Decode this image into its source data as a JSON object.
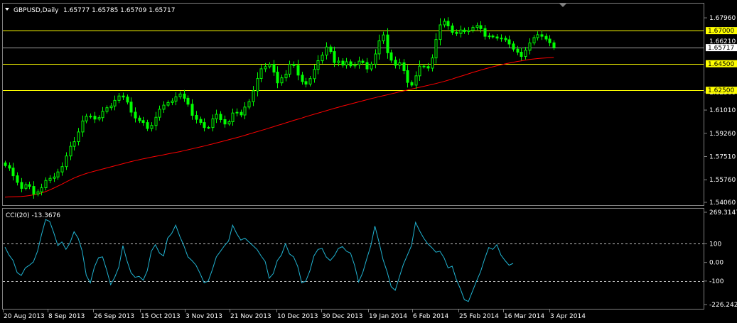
{
  "price_panel": {
    "symbol": "GBPUSD,Daily",
    "ohlc": "1.65777 1.65785 1.65709 1.65717"
  },
  "cci_panel": {
    "label": "CCI(20) -13.3676"
  },
  "colors": {
    "background": "#000000",
    "candle": "#00ff00",
    "ma": "#ff0000",
    "hline": "#ffff00",
    "bid_line": "#a0a0a0",
    "cci_line": "#20b2d0",
    "label_highlight": "#ffff00",
    "label_current": "#ffffff"
  },
  "chart_data": [
    {
      "type": "line",
      "title": "GBPUSD,Daily",
      "ylim": [
        1.5406,
        1.6818
      ],
      "y_ticks": [
        "1.67960",
        "1.62360",
        "1.61010",
        "1.59260",
        "1.57510",
        "1.55760",
        "1.54060"
      ],
      "x_labels": [
        "20 Aug 2013",
        "8 Sep 2013",
        "26 Sep 2013",
        "15 Oct 2013",
        "3 Nov 2013",
        "21 Nov 2013",
        "10 Dec 2013",
        "30 Dec 2013",
        "19 Jan 2014",
        "6 Feb 2014",
        "25 Feb 2014",
        "16 Mar 2014",
        "3 Apr 2014"
      ],
      "series": [
        {
          "values": [
            1.5683,
            1.5664,
            1.5606,
            1.5556,
            1.5511,
            1.5539,
            1.5526,
            1.5469,
            1.5485,
            1.5516,
            1.5571,
            1.5587,
            1.5597,
            1.5635,
            1.5675,
            1.5755,
            1.5828,
            1.5863,
            1.5936,
            1.6019,
            1.6054,
            1.6055,
            1.6033,
            1.6044,
            1.6091,
            1.6119,
            1.6132,
            1.6174,
            1.6207,
            1.6199,
            1.6161,
            1.6085,
            1.6041,
            1.6022,
            1.6007,
            1.5962,
            1.5985,
            1.6047,
            1.6107,
            1.6138,
            1.6158,
            1.6169,
            1.6201,
            1.6222,
            1.619,
            1.6145,
            1.6061,
            1.6031,
            1.6007,
            1.5969,
            1.597,
            1.6035,
            1.6069,
            1.6029,
            1.5996,
            1.6013,
            1.6079,
            1.6084,
            1.6064,
            1.6124,
            1.6164,
            1.6246,
            1.6339,
            1.6412,
            1.6428,
            1.6446,
            1.6387,
            1.6306,
            1.6344,
            1.6372,
            1.6446,
            1.6437,
            1.6364,
            1.6316,
            1.6297,
            1.6338,
            1.6408,
            1.6473,
            1.6515,
            1.6576,
            1.6542,
            1.6459,
            1.647,
            1.644,
            1.6465,
            1.6434,
            1.6443,
            1.647,
            1.6459,
            1.6411,
            1.6447,
            1.6524,
            1.6622,
            1.6667,
            1.6533,
            1.6477,
            1.6439,
            1.6457,
            1.6398,
            1.6309,
            1.6289,
            1.6359,
            1.6432,
            1.6429,
            1.6417,
            1.6494,
            1.6633,
            1.6743,
            1.677,
            1.6735,
            1.6687,
            1.6678,
            1.6704,
            1.6692,
            1.6701,
            1.6724,
            1.6738,
            1.6715,
            1.6657,
            1.6659,
            1.6652,
            1.6643,
            1.6642,
            1.6631,
            1.6599,
            1.656,
            1.6537,
            1.6505,
            1.6552,
            1.6607,
            1.6647,
            1.6669,
            1.6657,
            1.6636,
            1.6608,
            1.6572
          ]
        },
        {
          "name": "MA",
          "values": [
            1.5445,
            1.5447,
            1.5448,
            1.5449,
            1.545,
            1.5453,
            1.5457,
            1.5462,
            1.5468,
            1.5477,
            1.5487,
            1.5499,
            1.5513,
            1.5528,
            1.5543,
            1.5559,
            1.5574,
            1.5589,
            1.5602,
            1.5613,
            1.5623,
            1.5632,
            1.5641,
            1.5649,
            1.5657,
            1.5665,
            1.5673,
            1.5681,
            1.5689,
            1.5697,
            1.5705,
            1.5713,
            1.572,
            1.5727,
            1.5734,
            1.574,
            1.5746,
            1.5752,
            1.5758,
            1.5764,
            1.577,
            1.5776,
            1.5782,
            1.5788,
            1.5795,
            1.5802,
            1.5809,
            1.5816,
            1.5823,
            1.583,
            1.5838,
            1.5845,
            1.5853,
            1.5861,
            1.5869,
            1.5877,
            1.5885,
            1.5893,
            1.5902,
            1.5911,
            1.592,
            1.5929,
            1.5938,
            1.5947,
            1.5956,
            1.5966,
            1.5975,
            1.5985,
            1.5994,
            1.6004,
            1.6013,
            1.6023,
            1.6032,
            1.6041,
            1.6051,
            1.606,
            1.6069,
            1.6078,
            1.6087,
            1.6096,
            1.6105,
            1.6114,
            1.6122,
            1.6131,
            1.6139,
            1.6147,
            1.6155,
            1.6163,
            1.6171,
            1.6179,
            1.6187,
            1.6194,
            1.6202,
            1.6209,
            1.6216,
            1.6223,
            1.623,
            1.6238,
            1.6245,
            1.6252,
            1.6259,
            1.6266,
            1.6273,
            1.628,
            1.6287,
            1.6294,
            1.6301,
            1.6309,
            1.6317,
            1.6326,
            1.6335,
            1.6345,
            1.6355,
            1.6364,
            1.6374,
            1.6384,
            1.6393,
            1.6402,
            1.6411,
            1.6419,
            1.6427,
            1.6435,
            1.6442,
            1.6449,
            1.6455,
            1.6461,
            1.6467,
            1.6472,
            1.6477,
            1.6482,
            1.6486,
            1.6489,
            1.6492,
            1.6494,
            1.6496,
            1.6497
          ]
        }
      ],
      "hlines": [
        {
          "value": 1.67,
          "label": "1.67000",
          "label_bg": "#ffff00"
        },
        {
          "value": 1.645,
          "label": "1.64500",
          "label_bg": "#ffff00"
        },
        {
          "value": 1.625,
          "label": "1.62500",
          "label_bg": "#ffff00"
        },
        {
          "value": 1.65717,
          "label": "1.65717",
          "label_bg": "#ffffff"
        }
      ],
      "partial_tick_label": "1.66210",
      "grid": false,
      "legend": "none"
    },
    {
      "type": "line",
      "title": "CCI(20) -13.3676",
      "ylim": [
        -226.2421,
        269.3147
      ],
      "y_ticks": [
        "269.3147",
        "100",
        "0.00",
        "-100",
        "-226.2421"
      ],
      "levels": [
        100,
        -100
      ],
      "series": [
        {
          "name": "CCI(20)",
          "values": [
            82,
            40,
            10,
            -55,
            -70,
            -30,
            -15,
            3,
            60,
            150,
            230,
            220,
            160,
            90,
            110,
            70,
            105,
            165,
            130,
            60,
            -70,
            -110,
            -25,
            25,
            30,
            -40,
            -120,
            -80,
            -25,
            90,
            10,
            -55,
            -80,
            -75,
            -95,
            -45,
            60,
            95,
            50,
            35,
            130,
            155,
            200,
            140,
            90,
            30,
            10,
            -15,
            -60,
            -110,
            -100,
            -40,
            30,
            60,
            90,
            115,
            200,
            155,
            120,
            130,
            110,
            90,
            70,
            35,
            5,
            -85,
            -60,
            10,
            40,
            100,
            45,
            30,
            -20,
            -110,
            -100,
            -45,
            35,
            70,
            75,
            30,
            10,
            35,
            75,
            85,
            60,
            50,
            -15,
            -105,
            -55,
            20,
            90,
            195,
            110,
            15,
            -50,
            -130,
            -150,
            -80,
            -10,
            40,
            90,
            215,
            170,
            130,
            100,
            80,
            55,
            60,
            25,
            -30,
            -20,
            -90,
            -140,
            -200,
            -210,
            -155,
            -100,
            -50,
            20,
            80,
            70,
            95,
            40,
            10,
            -15,
            -5
          ]
        }
      ],
      "grid": false,
      "legend": "none"
    }
  ]
}
